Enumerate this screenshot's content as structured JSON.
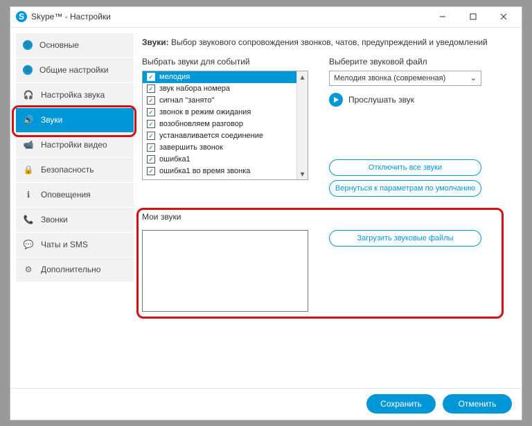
{
  "titlebar": {
    "title": "Skype™ - Настройки"
  },
  "sidebar": {
    "items": [
      {
        "label": "Основные",
        "icon": "S"
      },
      {
        "label": "Общие настройки",
        "icon": "S"
      },
      {
        "label": "Настройка звука",
        "icon": "🎧"
      },
      {
        "label": "Звуки",
        "icon": "🔊",
        "active": true
      },
      {
        "label": "Настройки видео",
        "icon": "📹"
      },
      {
        "label": "Безопасность",
        "icon": "🔒"
      },
      {
        "label": "Оповещения",
        "icon": "ℹ"
      },
      {
        "label": "Звонки",
        "icon": "📞"
      },
      {
        "label": "Чаты и SMS",
        "icon": "💬"
      },
      {
        "label": "Дополнительно",
        "icon": "⚙"
      }
    ]
  },
  "header": {
    "bold": "Звуки:",
    "rest": " Выбор звукового сопровождения звонков, чатов, предупреждений и уведомлений"
  },
  "events": {
    "title": "Выбрать звуки для событий",
    "list": [
      "мелодия",
      "звук набора номера",
      "сигнал \"занято\"",
      "звонок в режим ожидания",
      "возобновляем разговор",
      "устанавливается соединение",
      "завершить звонок",
      "ошибка1",
      "ошибка1 во время звонка"
    ]
  },
  "file": {
    "title": "Выберите звуковой файл",
    "selected": "Мелодия звонка (современная)",
    "play": "Прослушать звук"
  },
  "actions": {
    "disable": "Отключить все звуки",
    "reset": "Вернуться к параметрам по умолчанию"
  },
  "mysounds": {
    "title": "Мои звуки",
    "upload": "Загрузить звуковые файлы"
  },
  "footer": {
    "save": "Сохранить",
    "cancel": "Отменить"
  }
}
